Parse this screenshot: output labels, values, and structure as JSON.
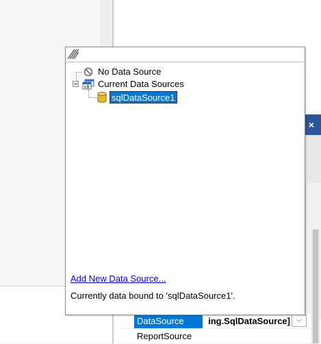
{
  "popup": {
    "tree": {
      "no_data_source": "No Data Source",
      "current_data_sources": "Current Data Sources",
      "selected_source": "sqlDataSource1"
    },
    "add_link": "Add New Data Source...",
    "status": "Currently data bound to 'sqlDataSource1'."
  },
  "window": {
    "close_glyph": "×"
  },
  "properties": {
    "rows": [
      {
        "name": "DataSource",
        "value": "ing.SqlDataSource]",
        "selected": true
      },
      {
        "name": "ReportSource",
        "value": ""
      }
    ],
    "dropdown_glyph": "⌵"
  },
  "icons": {
    "no_data_source": "no-entry-icon",
    "current_data_sources": "data-sources-icon",
    "sql_source": "database-cylinder-icon",
    "grip": "resize-grip-icon"
  },
  "colors": {
    "selection": "#0078d7",
    "link": "#0000ee",
    "close_button": "#2b579a"
  }
}
